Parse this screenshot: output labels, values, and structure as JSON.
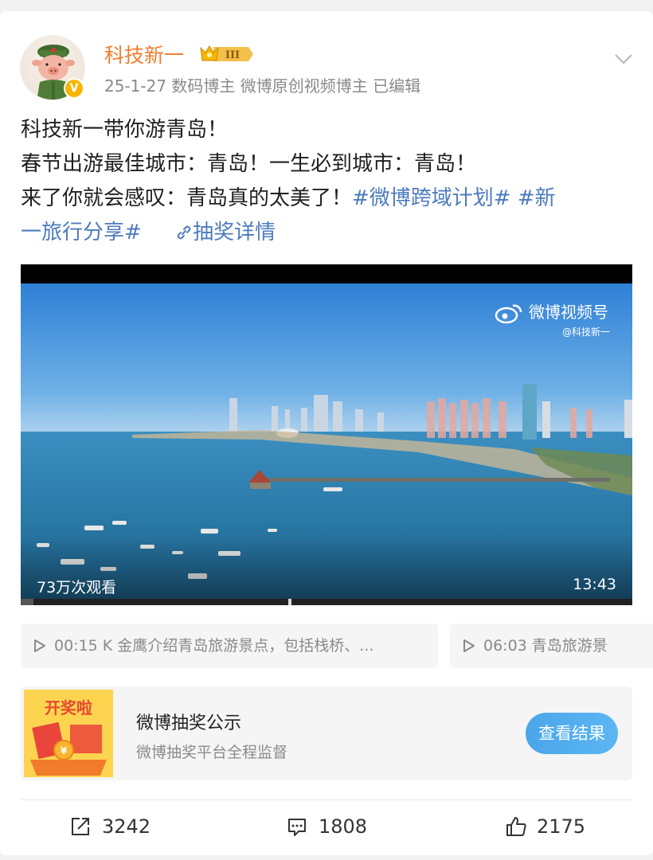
{
  "post": {
    "author": "科技新一",
    "author_badge": "III",
    "meta": "25-1-27  数码博主 微博原创视频博主 已编辑",
    "content": {
      "line1": "科技新一带你游青岛！",
      "line2": "春节出游最佳城市：青岛！一生必到城市：青岛！",
      "line3_text": "来了你就会感叹：青岛真的太美了！",
      "tag1": "#微博跨域计划#",
      "tag2_start": " #新",
      "tag2_end": "一旅行分享#",
      "lottery_link": "抽奖详情"
    }
  },
  "video": {
    "watermark": "微博视频号",
    "watermark_handle": "@科技新一",
    "views": "73万次观看",
    "duration": "13:43"
  },
  "chapters": [
    {
      "text": "00:15 K 金鹰介绍青岛旅游景点，包括栈桥、..."
    },
    {
      "text": "06:03 青岛旅游景"
    }
  ],
  "lottery": {
    "badge_text": "开奖啦",
    "title": "微博抽奖公示",
    "subtitle": "微博抽奖平台全程监督",
    "button": "查看结果"
  },
  "actions": {
    "repost_count": "3242",
    "comment_count": "1808",
    "like_count": "2175"
  },
  "colors": {
    "username": "#f07d2f",
    "tag": "#4d7bbd",
    "button": "#4aa6ea"
  }
}
